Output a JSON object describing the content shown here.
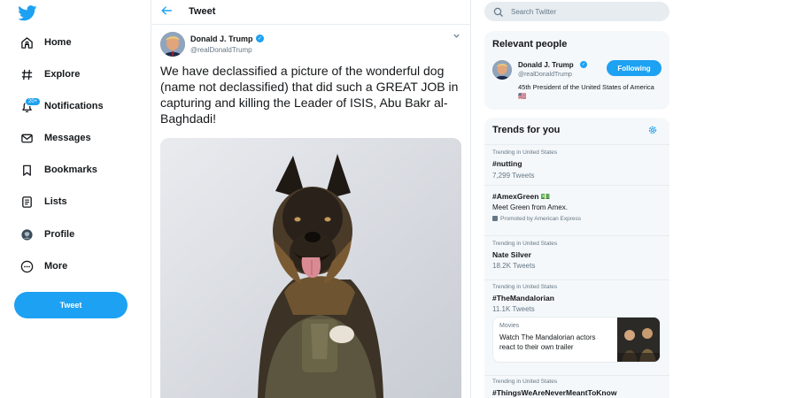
{
  "colors": {
    "accent": "#1da1f2",
    "text": "#14171a",
    "muted": "#657786",
    "panel": "#f5f8fa"
  },
  "nav": {
    "logo_icon": "twitter-bird-icon",
    "items": [
      {
        "label": "Home",
        "icon": "home-icon"
      },
      {
        "label": "Explore",
        "icon": "hashtag-icon"
      },
      {
        "label": "Notifications",
        "icon": "bell-icon",
        "badge": "20+"
      },
      {
        "label": "Messages",
        "icon": "envelope-icon"
      },
      {
        "label": "Bookmarks",
        "icon": "bookmark-icon"
      },
      {
        "label": "Lists",
        "icon": "list-icon"
      },
      {
        "label": "Profile",
        "icon": "profile-icon"
      },
      {
        "label": "More",
        "icon": "more-icon"
      }
    ],
    "tweet_button": "Tweet"
  },
  "main": {
    "header_title": "Tweet",
    "tweet": {
      "author_name": "Donald J. Trump",
      "author_handle": "@realDonaldTrump",
      "text": "We have declassified a picture of the wonderful dog (name not declassified) that did such a GREAT JOB in capturing and killing the Leader of ISIS, Abu Bakr al-Baghdadi!"
    }
  },
  "search": {
    "placeholder": "Search Twitter"
  },
  "relevant_people": {
    "title": "Relevant people",
    "person": {
      "name": "Donald J. Trump",
      "handle": "@realDonaldTrump",
      "bio": "45th President of the United States of America🇺🇸",
      "follow_label": "Following"
    }
  },
  "trends": {
    "title": "Trends for you",
    "items": [
      {
        "meta": "Trending in United States",
        "name": "#nutting",
        "count": "7,299 Tweets"
      },
      {
        "meta": "",
        "name": "#AmexGreen 💵",
        "count": "Meet Green from Amex.",
        "promoted": "Promoted by American Express"
      },
      {
        "meta": "Trending in United States",
        "name": "Nate Silver",
        "count": "18.2K Tweets"
      },
      {
        "meta": "Trending in United States",
        "name": "#TheMandalorian",
        "count": "11.1K Tweets"
      },
      {
        "meta": "Trending in United States",
        "name": "#ThingsWeAreNeverMeantToKnow",
        "count": ""
      }
    ],
    "card": {
      "category": "Movies",
      "text": "Watch The Mandalorian actors react to their own trailer"
    }
  }
}
